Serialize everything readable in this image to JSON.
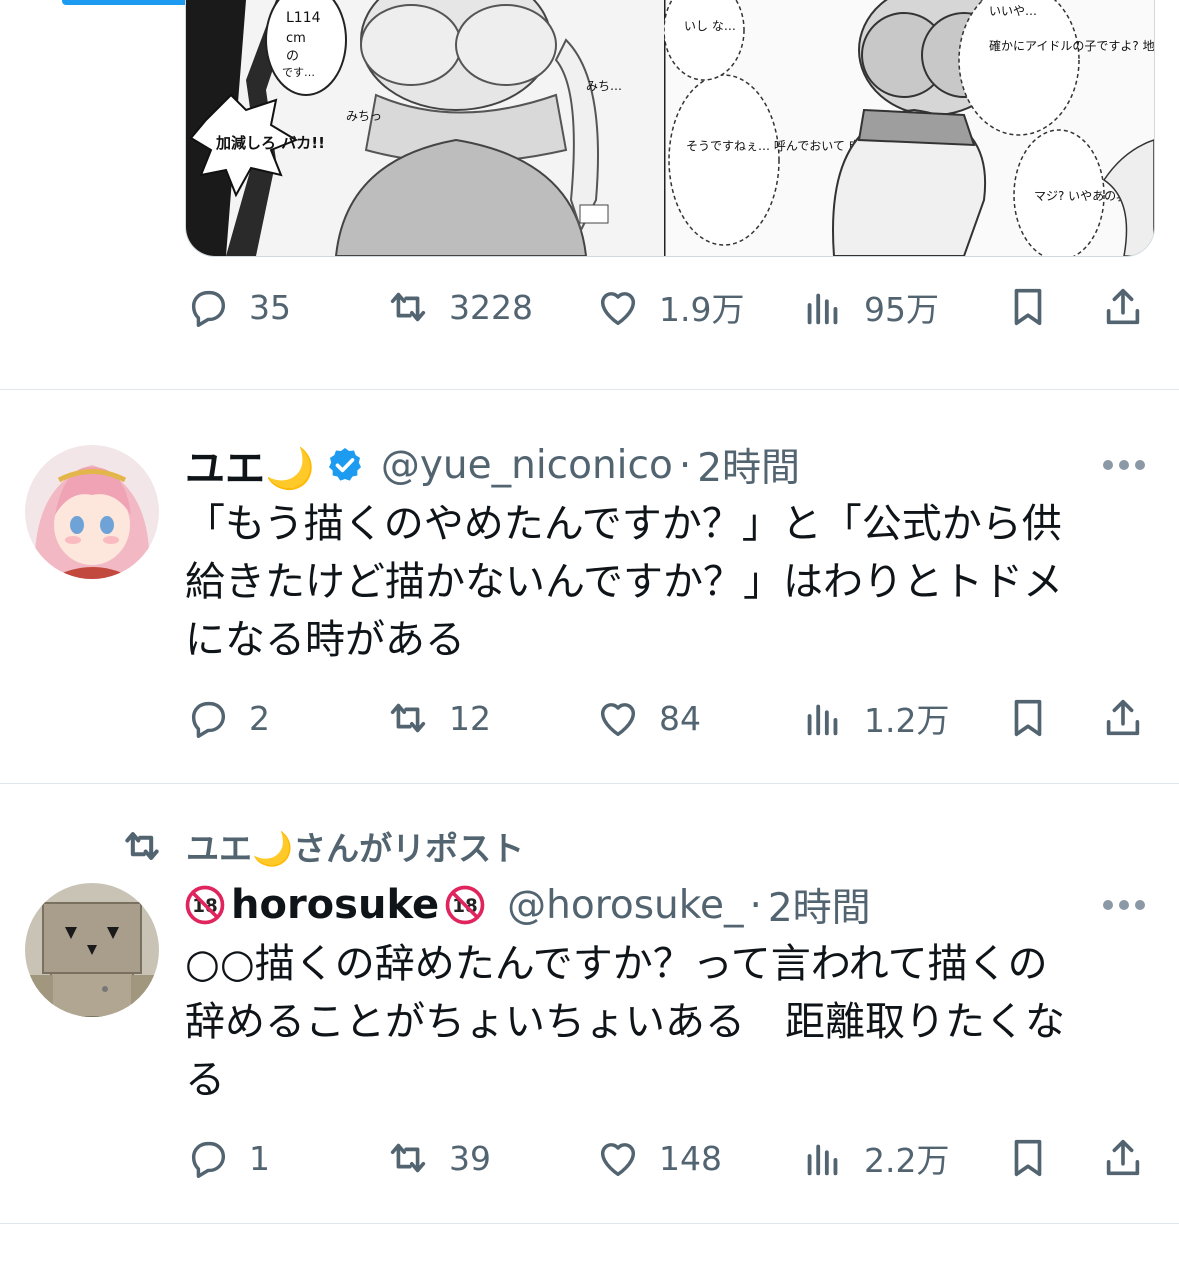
{
  "colors": {
    "accent": "#1d9bf0",
    "muted": "#536471",
    "text": "#0f1419",
    "separator": "#e1e6ea"
  },
  "tweet1": {
    "media": {
      "panel_left_text": [
        "L114",
        "cm",
        "の",
        "です…"
      ],
      "panel_left_shout": "加減しろ バカ!!",
      "panel_left_sfx": [
        "みち…",
        "みちっ"
      ],
      "panel_right_bubble1": "そうですねぇ… 呼んでおいて 申し訳ないですけど…",
      "panel_right_bubble2": "確かにアイドルの子ですよ? 地下寄りですけど…",
      "panel_right_bubble3": "マジ? いやあの乳 アイドルは 無理あるだ",
      "panel_right_bubble4": "いいや…",
      "panel_right_bubble5": "いし な…"
    },
    "actions": {
      "reply": "35",
      "repost": "3228",
      "like": "1.9万",
      "views": "95万"
    }
  },
  "tweet2": {
    "name": "ユエ🌙",
    "verified": true,
    "handle": "@yue_niconico",
    "dot": "·",
    "time": "2時間",
    "text": "「もう描くのやめたんですか？」と「公式から供\n給きたけど描かないんですか？」はわりとトドメ\nになる時がある",
    "actions": {
      "reply": "2",
      "repost": "12",
      "like": "84",
      "views": "1.2万"
    }
  },
  "tweet3": {
    "reposted_by": "ユエ🌙さんがリポスト",
    "name": "horosuke",
    "handle": "@horosuke_",
    "dot": "·",
    "time": "2時間",
    "text": "○○描くの辞めたんですか？って言われて描くの\n辞めることがちょいちょいある　距離取りたくな\nる",
    "actions": {
      "reply": "1",
      "repost": "39",
      "like": "148",
      "views": "2.2万"
    }
  }
}
